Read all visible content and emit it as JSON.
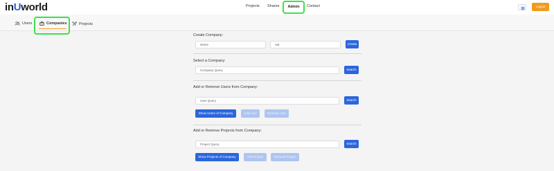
{
  "app": {
    "logo_prefix": "in",
    "logo_u": "U",
    "logo_suffix": "world"
  },
  "nav": {
    "projects": "Projects",
    "shares": "Shares",
    "admin": "Admin",
    "contact": "Contact",
    "logout": "Logout"
  },
  "tabs": {
    "users": "Users",
    "companies": "Companies",
    "projects": "Projects"
  },
  "create_company": {
    "title": "Create Company:",
    "name_placeholder": "Name",
    "vat_placeholder": "Vat",
    "create_label": "Create"
  },
  "select_company": {
    "title": "Select a Company:",
    "query_placeholder": "Company Query",
    "search_label": "Search"
  },
  "users_company": {
    "title": "Add or Remove Users from Company:",
    "query_placeholder": "User Query",
    "search_label": "Search",
    "show_label": "Show Users of Company",
    "add_label": "Add User",
    "remove_label": "Remove User"
  },
  "projects_company": {
    "title": "Add or Remove Projects from Company:",
    "query_placeholder": "Project Query",
    "search_label": "Search",
    "show_label": "Show Projects of Company",
    "add_label": "Add Project",
    "remove_label": "Remove Project"
  },
  "colors": {
    "accent": "#2b66dd",
    "logout": "#f39a1d",
    "highlight": "#3ee04a"
  }
}
